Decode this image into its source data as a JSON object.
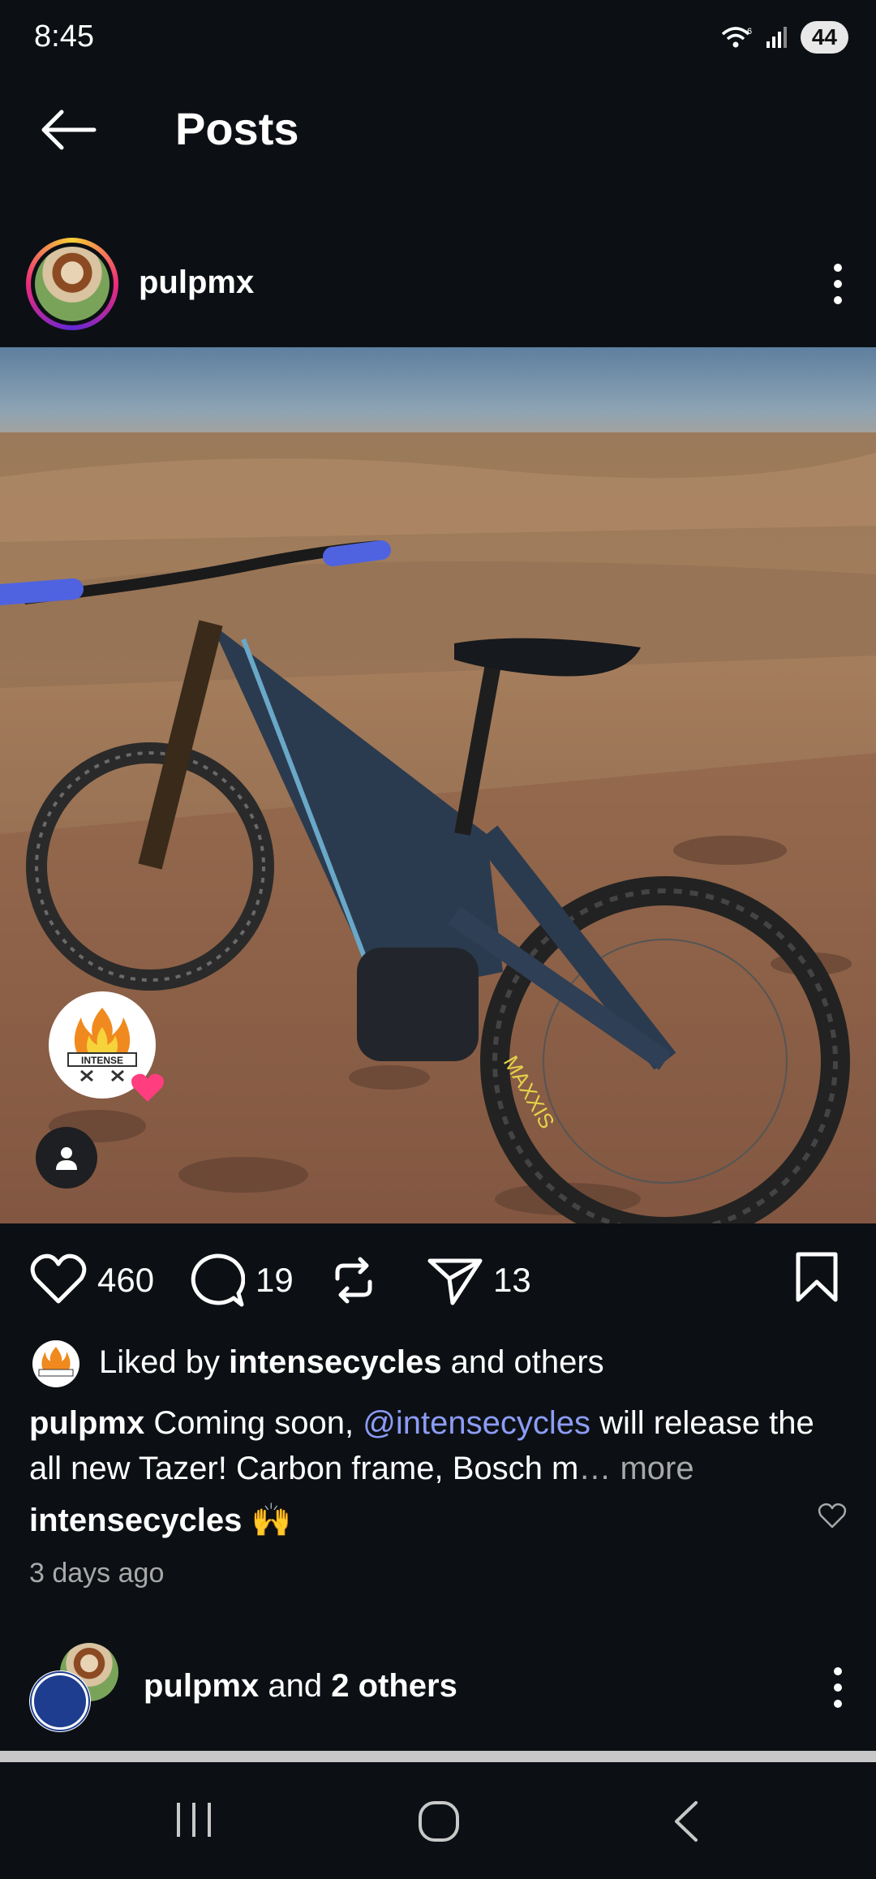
{
  "status": {
    "time": "8:45",
    "battery": "44",
    "wifi_badge": "6"
  },
  "header": {
    "title": "Posts"
  },
  "post": {
    "username": "pulpmx",
    "tag_logo_text": "INTENSE",
    "actions": {
      "likes": "460",
      "comments": "19",
      "shares": "13"
    },
    "liked_by": {
      "prefix": "Liked by ",
      "user": "intensecycles",
      "suffix": " and others"
    },
    "caption": {
      "user": "pulpmx",
      "text1": " Coming soon, ",
      "mention": "@intensecycles",
      "text2": " will release the all new Tazer! Carbon frame, Bosch m",
      "ellipsis": "…",
      "more": " more"
    },
    "top_comment": {
      "user": "intensecycles",
      "emoji": " 🙌"
    },
    "time": "3 days ago"
  },
  "next_post": {
    "user": "pulpmx",
    "middle": " and ",
    "others": "2 others"
  },
  "colors": {
    "background": "#0c1014",
    "mention": "#8c9cf5",
    "secondary": "#a8a8a8"
  }
}
